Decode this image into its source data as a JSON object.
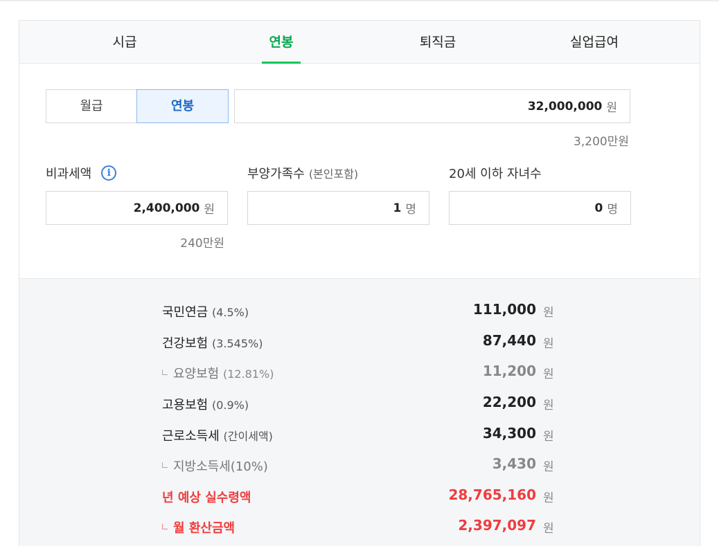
{
  "tabs": [
    {
      "label": "시급",
      "active": false
    },
    {
      "label": "연봉",
      "active": true
    },
    {
      "label": "퇴직금",
      "active": false
    },
    {
      "label": "실업급여",
      "active": false
    }
  ],
  "pay_type": {
    "monthly": "월급",
    "annual": "연봉",
    "selected": "연봉"
  },
  "salary": {
    "value": "32,000,000",
    "unit": "원",
    "hint": "3,200만원"
  },
  "nontax": {
    "label": "비과세액",
    "value": "2,400,000",
    "unit": "원",
    "hint": "240만원"
  },
  "dependents": {
    "label": "부양가족수",
    "sub": "(본인포함)",
    "value": "1",
    "unit": "명"
  },
  "children": {
    "label": "20세 이하 자녀수",
    "value": "0",
    "unit": "명"
  },
  "results": [
    {
      "name": "국민연금",
      "pct": "(4.5%)",
      "value": "111,000",
      "unit": "원"
    },
    {
      "name": "건강보험",
      "pct": "(3.545%)",
      "value": "87,440",
      "unit": "원"
    },
    {
      "name": "요양보험",
      "pct": "(12.81%)",
      "value": "11,200",
      "unit": "원"
    },
    {
      "name": "고용보험",
      "pct": "(0.9%)",
      "value": "22,200",
      "unit": "원"
    },
    {
      "name": "근로소득세",
      "pct": "(간이세액)",
      "value": "34,300",
      "unit": "원"
    },
    {
      "name": "지방소득세(10%)",
      "pct": "",
      "value": "3,430",
      "unit": "원"
    },
    {
      "name": "년 예상 실수령액",
      "pct": "",
      "value": "28,765,160",
      "unit": "원"
    },
    {
      "name": "월 환산금액",
      "pct": "",
      "value": "2,397,097",
      "unit": "원"
    }
  ],
  "colors": {
    "accent_green": "#03c75a",
    "selected_blue": "#1a66c8",
    "highlight_red": "#f03c3c"
  }
}
